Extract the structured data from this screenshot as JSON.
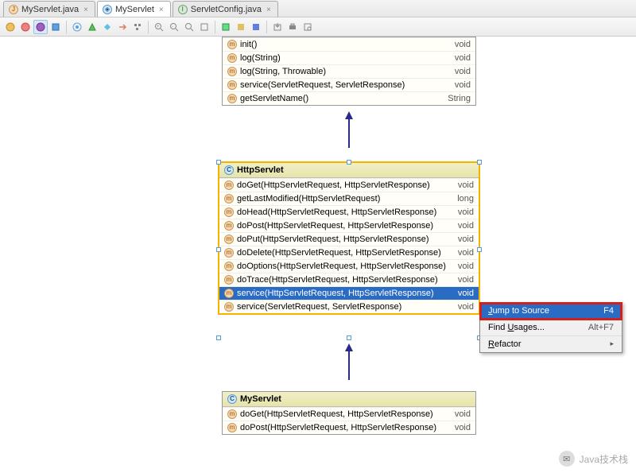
{
  "tabs": [
    {
      "label": "MyServlet.java",
      "icon": "j"
    },
    {
      "label": "MyServlet",
      "icon": "d"
    },
    {
      "label": "ServletConfig.java",
      "icon": "i"
    }
  ],
  "activeTab": 1,
  "topClass": {
    "methods": [
      {
        "sig": "init()",
        "ret": "void",
        "vis": "m"
      },
      {
        "sig": "log(String)",
        "ret": "void",
        "vis": "m"
      },
      {
        "sig": "log(String, Throwable)",
        "ret": "void",
        "vis": "m"
      },
      {
        "sig": "service(ServletRequest, ServletResponse)",
        "ret": "void",
        "vis": "m"
      },
      {
        "sig": "getServletName()",
        "ret": "String",
        "vis": "m"
      }
    ]
  },
  "mid": {
    "title": "HttpServlet",
    "methods": [
      {
        "sig": "doGet(HttpServletRequest, HttpServletResponse)",
        "ret": "void",
        "vis": "m"
      },
      {
        "sig": "getLastModified(HttpServletRequest)",
        "ret": "long",
        "vis": "m"
      },
      {
        "sig": "doHead(HttpServletRequest, HttpServletResponse)",
        "ret": "void",
        "vis": "m"
      },
      {
        "sig": "doPost(HttpServletRequest, HttpServletResponse)",
        "ret": "void",
        "vis": "m"
      },
      {
        "sig": "doPut(HttpServletRequest, HttpServletResponse)",
        "ret": "void",
        "vis": "m"
      },
      {
        "sig": "doDelete(HttpServletRequest, HttpServletResponse)",
        "ret": "void",
        "vis": "m"
      },
      {
        "sig": "doOptions(HttpServletRequest, HttpServletResponse)",
        "ret": "void",
        "vis": "m"
      },
      {
        "sig": "doTrace(HttpServletRequest, HttpServletResponse)",
        "ret": "void",
        "vis": "m"
      },
      {
        "sig": "service(HttpServletRequest, HttpServletResponse)",
        "ret": "void",
        "vis": "m",
        "selected": true
      },
      {
        "sig": "service(ServletRequest, ServletResponse)",
        "ret": "void",
        "vis": "m"
      }
    ]
  },
  "bot": {
    "title": "MyServlet",
    "methods": [
      {
        "sig": "doGet(HttpServletRequest, HttpServletResponse)",
        "ret": "void",
        "vis": "m"
      },
      {
        "sig": "doPost(HttpServletRequest, HttpServletResponse)",
        "ret": "void",
        "vis": "m"
      }
    ]
  },
  "context": [
    {
      "label": "Jump to Source",
      "short": "F4",
      "hl": true,
      "u": 0
    },
    {
      "label": "Find Usages...",
      "short": "Alt+F7",
      "u": 5
    },
    {
      "label": "Refactor",
      "short": "▸",
      "u": 0
    }
  ],
  "watermark": "Java技术栈"
}
